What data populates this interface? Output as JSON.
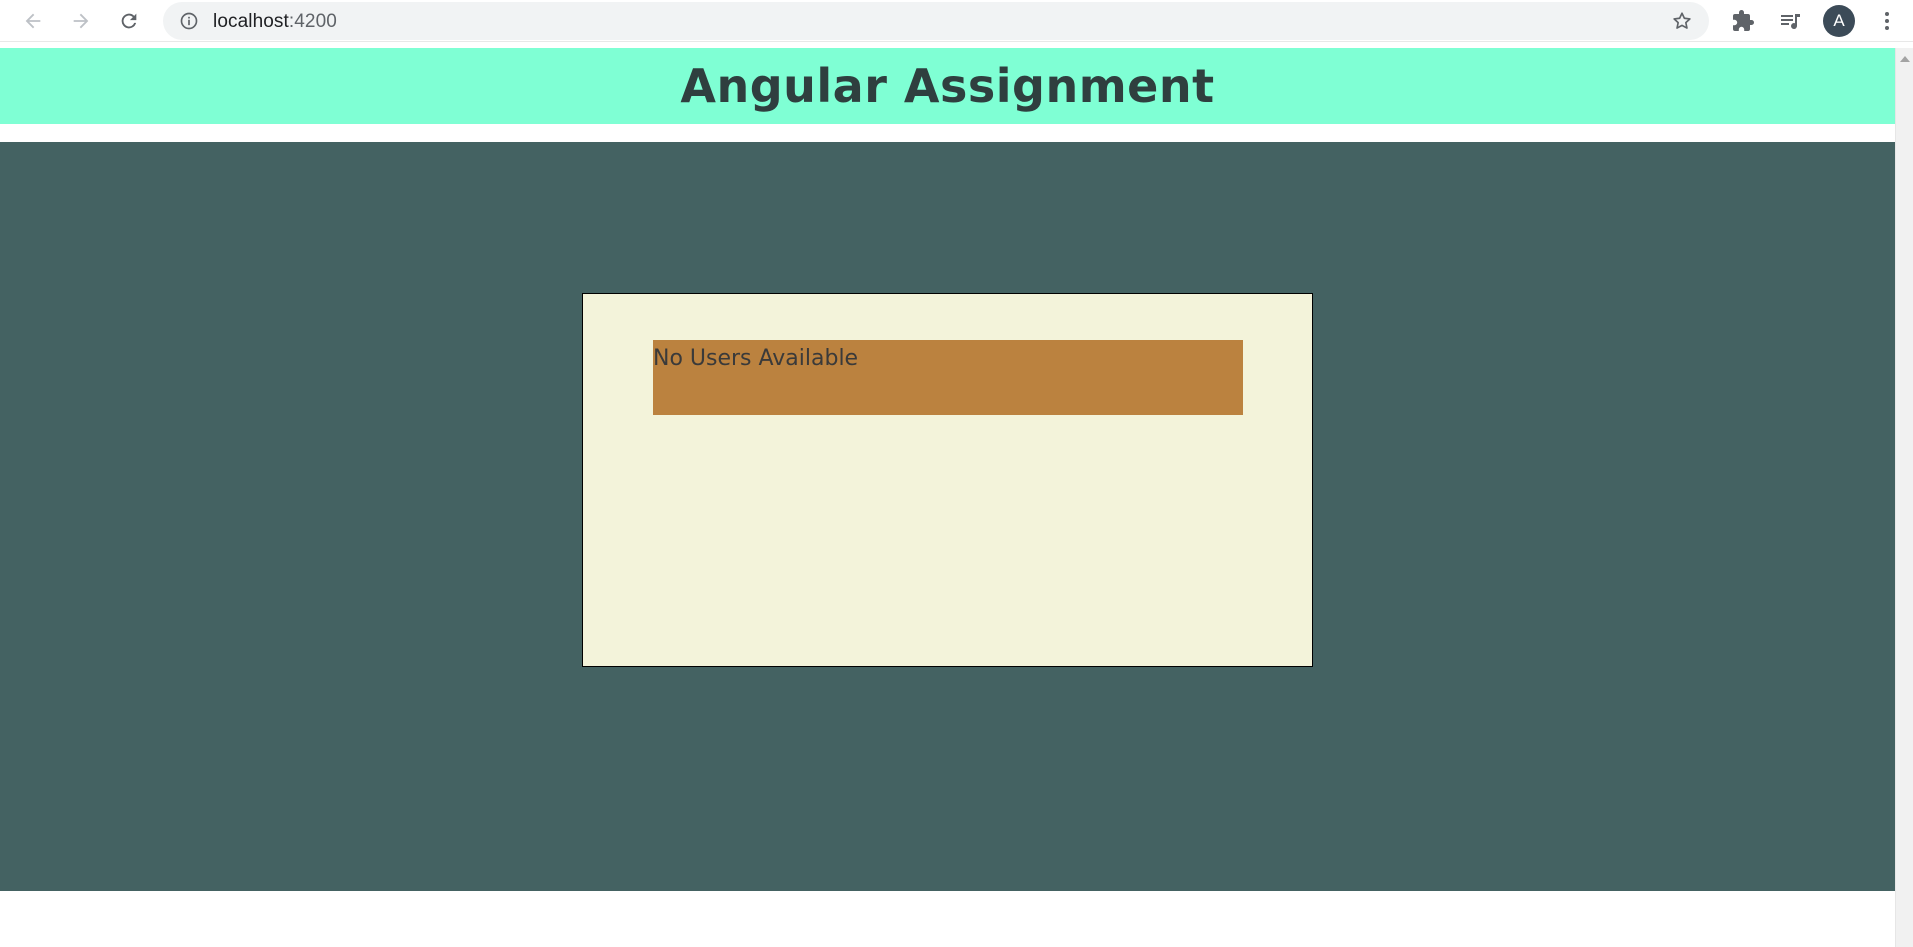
{
  "browser": {
    "url_host": "localhost",
    "url_port": ":4200",
    "avatar_letter": "A",
    "icons": {
      "back": "back-arrow-icon",
      "forward": "forward-arrow-icon",
      "reload": "reload-icon",
      "site_info": "info-icon",
      "bookmark": "star-icon",
      "extensions": "puzzle-icon",
      "media": "media-queue-icon",
      "menu": "kebab-menu-icon"
    }
  },
  "app": {
    "title": "Angular Assignment",
    "empty_message": "No Users Available"
  },
  "colors": {
    "header_bg": "#7fffd4",
    "main_bg": "#446262",
    "card_bg": "#f3f3da",
    "item_bg": "#bb823f"
  }
}
